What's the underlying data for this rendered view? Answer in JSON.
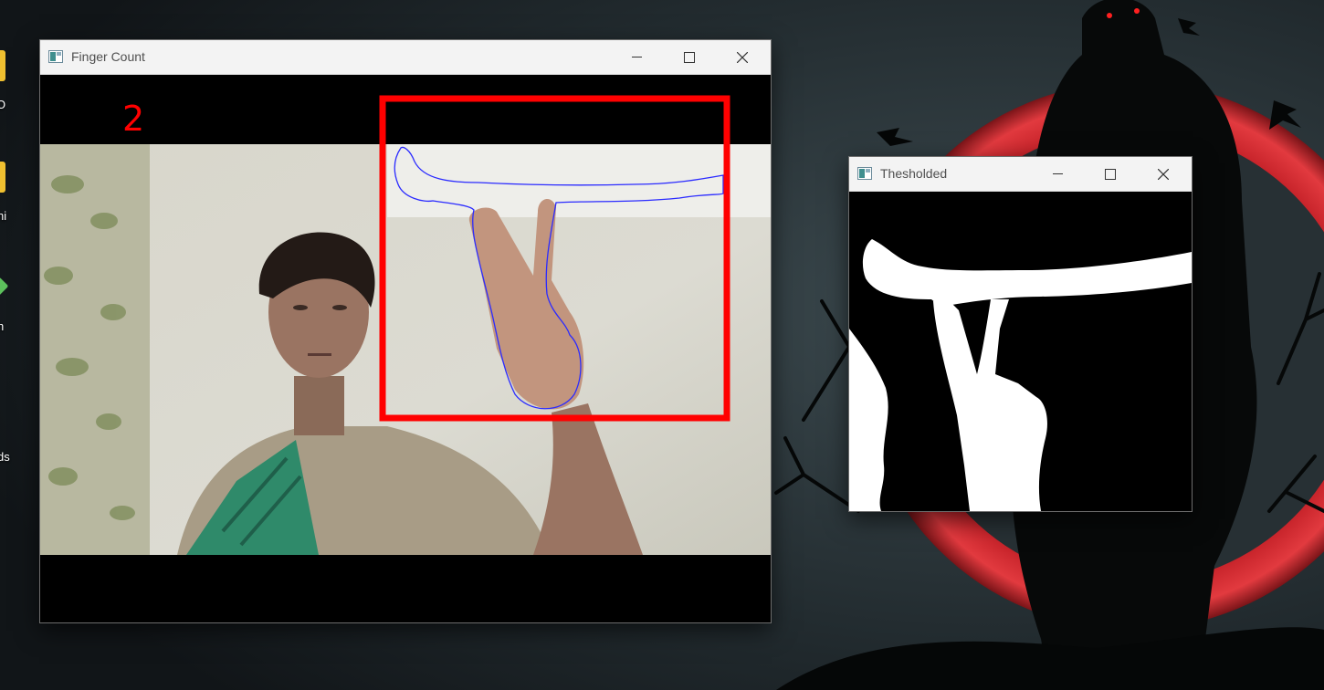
{
  "desktop": {
    "icons": [
      {
        "label": "O",
        "color": "#f0c030"
      },
      {
        "label": "ni",
        "color": "#f0c030"
      },
      {
        "label": "h",
        "color": "#5cc05c"
      },
      {
        "label": "ds",
        "color": ""
      }
    ]
  },
  "main_window": {
    "title": "Finger Count",
    "finger_count": "2",
    "roi_box_color": "#ff0000",
    "contour_color": "#2b2bff",
    "count_text_color": "#ff0000"
  },
  "threshold_window": {
    "title": "Thesholded"
  },
  "window_controls": {
    "minimize_icon": "minimize-icon",
    "maximize_icon": "maximize-icon",
    "close_icon": "close-icon"
  },
  "colors": {
    "accent_red": "#e0303a",
    "titlebar": "#f3f3f3"
  }
}
